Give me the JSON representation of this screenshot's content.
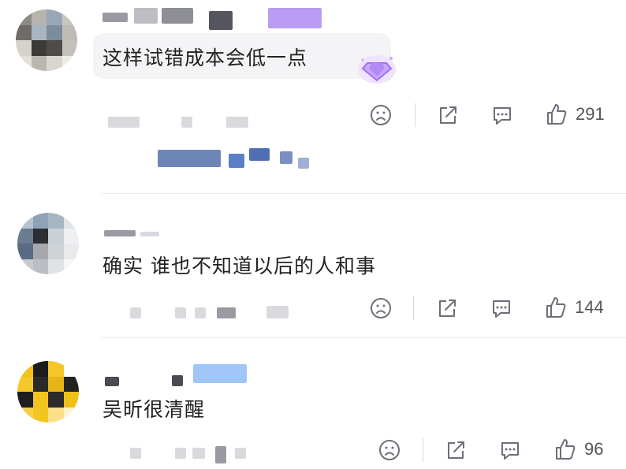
{
  "comments": [
    {
      "text": "这样试错成本会低一点",
      "likes": "291"
    },
    {
      "text": "确实 谁也不知道以后的人和事",
      "likes": "144"
    },
    {
      "text": "吴昕很清醒",
      "likes": "96"
    }
  ],
  "icons": {
    "dislike": "sad-face-icon",
    "share": "share-icon",
    "comment": "comment-icon",
    "like": "thumbs-up-icon",
    "badge": "diamond-badge-icon"
  },
  "colors": {
    "badge": "#a46cf5",
    "icon": "#6e6e78",
    "link_blur": "#5a7fc7"
  }
}
